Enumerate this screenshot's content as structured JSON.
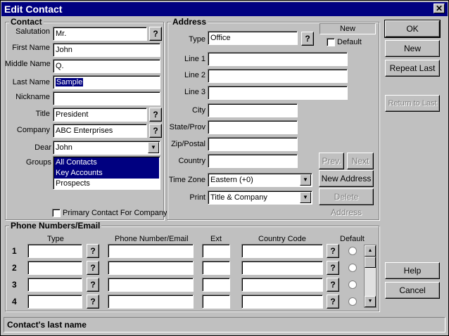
{
  "window": {
    "title": "Edit Contact",
    "close_glyph": "✕"
  },
  "contact": {
    "group_label": "Contact",
    "salutation": {
      "label": "Salutation",
      "value": "Mr."
    },
    "first_name": {
      "label": "First Name",
      "value": "John"
    },
    "middle_name": {
      "label": "Middle Name",
      "value": "Q."
    },
    "last_name": {
      "label": "Last Name",
      "value": "Sample"
    },
    "nickname": {
      "label": "Nickname",
      "value": ""
    },
    "title": {
      "label": "Title",
      "value": "President"
    },
    "company": {
      "label": "Company",
      "value": "ABC Enterprises"
    },
    "dear": {
      "label": "Dear",
      "value": "John"
    },
    "groups": {
      "label": "Groups",
      "items": [
        "All Contacts",
        "Key Accounts",
        "Prospects"
      ]
    },
    "primary_contact_label": "Primary Contact For Company"
  },
  "address": {
    "group_label": "Address",
    "new_header": "New",
    "type": {
      "label": "Type",
      "value": "Office"
    },
    "default_label": "Default",
    "line1": {
      "label": "Line 1",
      "value": ""
    },
    "line2": {
      "label": "Line 2",
      "value": ""
    },
    "line3": {
      "label": "Line 3",
      "value": ""
    },
    "city": {
      "label": "City",
      "value": ""
    },
    "state": {
      "label": "State/Prov",
      "value": ""
    },
    "zip": {
      "label": "Zip/Postal",
      "value": ""
    },
    "country": {
      "label": "Country",
      "value": ""
    },
    "timezone": {
      "label": "Time Zone",
      "value": "Eastern (+0)"
    },
    "print": {
      "label": "Print",
      "value": "Title & Company"
    },
    "buttons": {
      "prev": "Prev.",
      "next": "Next",
      "new_address": "New Address",
      "delete_address": "Delete Address"
    }
  },
  "side_buttons": {
    "ok": "OK",
    "new": "New",
    "repeat_last": "Repeat Last",
    "return_to_last": "Return to Last",
    "help": "Help",
    "cancel": "Cancel"
  },
  "phones": {
    "group_label": "Phone Numbers/Email",
    "headers": {
      "type": "Type",
      "number": "Phone Number/Email",
      "ext": "Ext",
      "country_code": "Country Code",
      "default": "Default"
    },
    "rows": [
      "1",
      "2",
      "3",
      "4"
    ],
    "q_glyph": "?"
  },
  "status": {
    "text": "Contact's last name"
  },
  "icons": {
    "help": "question-mark-icon",
    "dropdown": "down-arrow-icon"
  },
  "colors": {
    "title_bar": "#000080",
    "face": "#c0c0c0",
    "selection": "#000080"
  }
}
